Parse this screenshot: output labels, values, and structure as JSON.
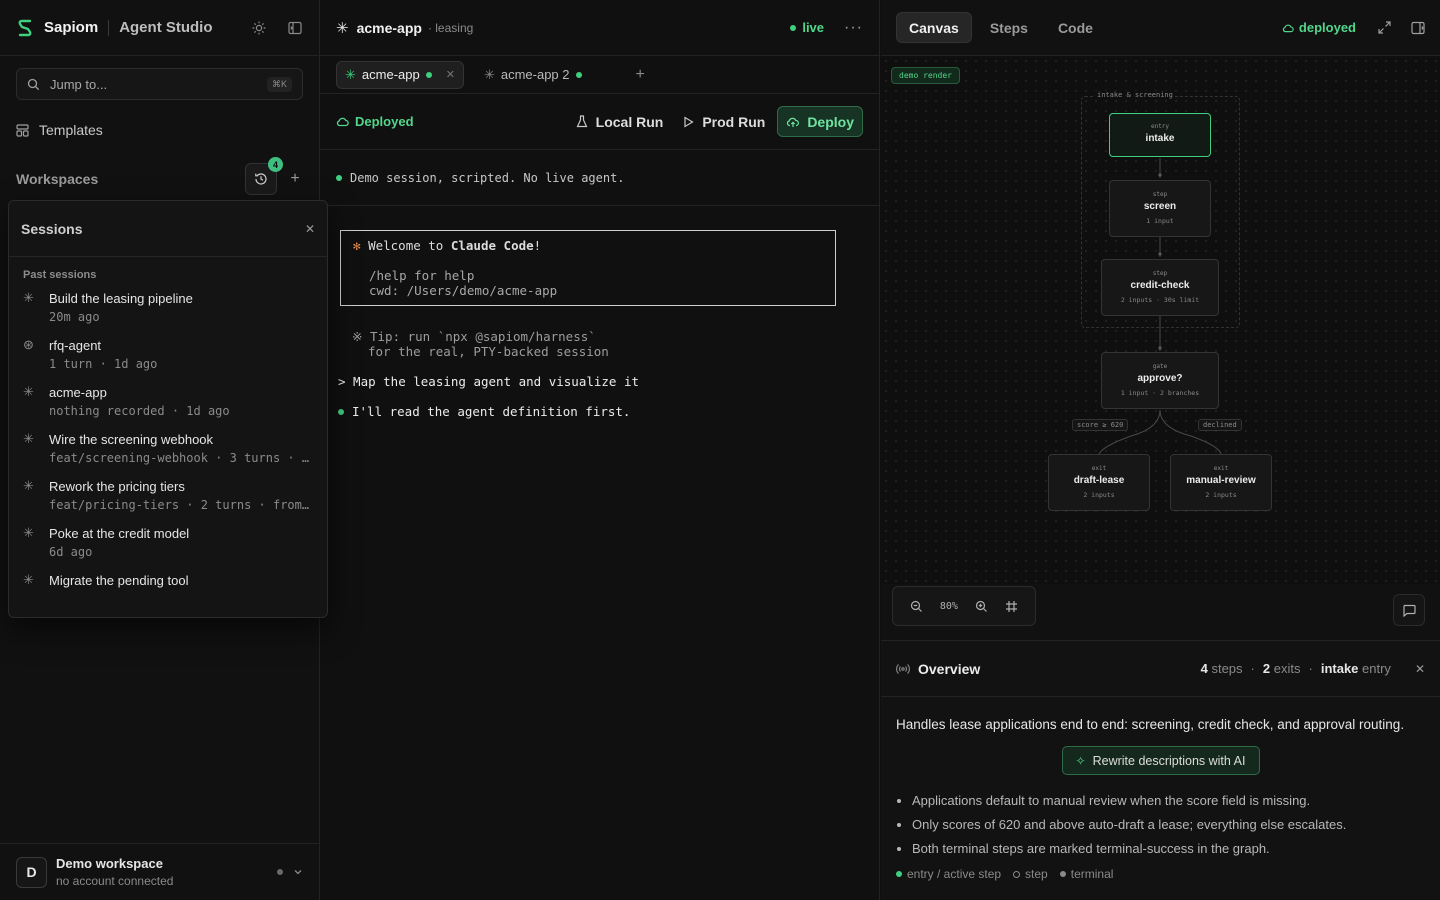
{
  "sidebar": {
    "brand": "Sapiom",
    "product": "Agent Studio",
    "jump_placeholder": "Jump to...",
    "jump_shortcut": "⌘K",
    "templates_label": "Templates",
    "workspaces_label": "Workspaces",
    "history_badge": "4",
    "sessions": {
      "title": "Sessions",
      "past_label": "Past sessions",
      "items": [
        {
          "icon": "asterisk-icon",
          "name": "Build the leasing pipeline",
          "meta": "20m ago"
        },
        {
          "icon": "openai-icon",
          "name": "rfq-agent",
          "meta": "1 turn · 1d ago"
        },
        {
          "icon": "asterisk-icon",
          "name": "acme-app",
          "meta": "nothing recorded · 1d ago"
        },
        {
          "icon": "asterisk-icon",
          "name": "Wire the screening webhook",
          "meta": "feat/screening-webhook · 3 turns · …"
        },
        {
          "icon": "asterisk-icon",
          "name": "Rework the pricing tiers",
          "meta": "feat/pricing-tiers · 2 turns · from…"
        },
        {
          "icon": "asterisk-icon",
          "name": "Poke at the credit model",
          "meta": "6d ago"
        },
        {
          "icon": "asterisk-icon",
          "name": "Migrate the pending tool",
          "meta": ""
        }
      ]
    },
    "footer": {
      "avatar": "D",
      "name": "Demo workspace",
      "sub": "no account connected"
    }
  },
  "middle": {
    "app_name": "acme-app",
    "app_sub": "· leasing",
    "live_label": "live",
    "tabs": [
      {
        "label": "acme-app",
        "active": true
      },
      {
        "label": "acme-app 2",
        "active": false
      }
    ],
    "deployed_label": "Deployed",
    "local_run": "Local Run",
    "prod_run": "Prod Run",
    "deploy": "Deploy",
    "notice": "Demo session, scripted. No live agent.",
    "terminal": {
      "welcome_prefix": "Welcome to ",
      "welcome_bold": "Claude Code",
      "welcome_suffix": "!",
      "help": "/help for help",
      "cwd": "cwd: /Users/demo/acme-app",
      "tip1": "※ Tip: run `npx @sapiom/harness`",
      "tip2": "for the real, PTY-backed session",
      "prompt": "> Map the leasing agent and visualize it",
      "reply": "I'll read the agent definition first."
    }
  },
  "right": {
    "tabs": [
      "Canvas",
      "Steps",
      "Code"
    ],
    "status": "deployed",
    "demo_tag": "demo render",
    "group_label": "intake & screening",
    "nodes": {
      "intake": {
        "kind": "entry",
        "name": "intake",
        "meta": ""
      },
      "screen": {
        "kind": "step",
        "name": "screen",
        "meta": "1 input"
      },
      "credit": {
        "kind": "step",
        "name": "credit-check",
        "meta": "2 inputs · 30s limit"
      },
      "approve": {
        "kind": "gate",
        "name": "approve?",
        "meta": "1 input · 2 branches"
      },
      "draft": {
        "kind": "exit",
        "name": "draft-lease",
        "meta": "2 inputs"
      },
      "manual": {
        "kind": "exit",
        "name": "manual-review",
        "meta": "2 inputs"
      }
    },
    "edge_labels": {
      "left": "score ≥ 620",
      "right": "declined"
    },
    "zoom": "80%",
    "overview": {
      "title": "Overview",
      "steps_n": "4",
      "steps_l": "steps",
      "exits_n": "2",
      "exits_l": "exits",
      "entry_n": "intake",
      "entry_l": "entry",
      "description": "Handles lease applications end to end: screening, credit check, and approval routing.",
      "rewrite": "Rewrite descriptions with AI",
      "bullets": [
        "Applications default to manual review when the score field is missing.",
        "Only scores of 620 and above auto-draft a lease; everything else escalates.",
        "Both terminal steps are marked terminal-success in the graph."
      ],
      "legend": [
        "entry / active step",
        "step",
        "terminal"
      ]
    }
  },
  "colors": {
    "accent": "#3fcf7f",
    "accent_text": "#52d68b",
    "claude_star": "#e0884a"
  }
}
